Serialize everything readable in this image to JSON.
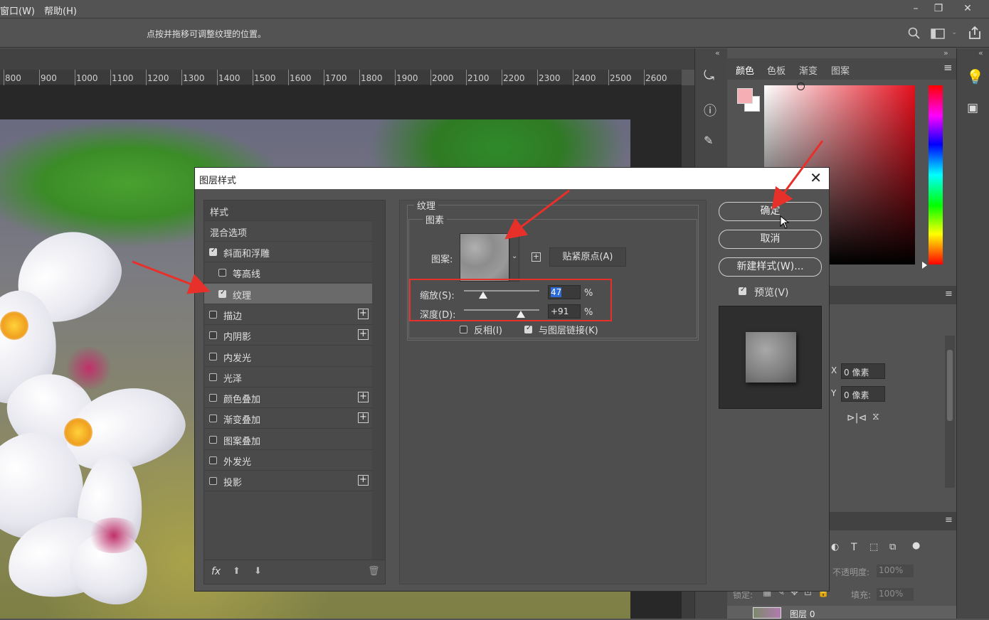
{
  "menubar": {
    "items": [
      "窗口(W)",
      "帮助(H)"
    ],
    "window_controls": [
      "minimize-icon",
      "restore-icon",
      "close-icon"
    ]
  },
  "options_bar": {
    "hint": "点按并拖移可调整纹理的位置。",
    "icons": [
      "search-icon",
      "workspace-icon",
      "share-icon"
    ]
  },
  "ruler": {
    "ticks": [
      "800",
      "900",
      "1000",
      "1100",
      "1200",
      "1300",
      "1400",
      "1500",
      "1600",
      "1700",
      "1800",
      "1900",
      "2000",
      "2100",
      "2200",
      "2300",
      "2400",
      "2500",
      "2600"
    ]
  },
  "color_panel": {
    "tabs": [
      "颜色",
      "色板",
      "渐变",
      "图案"
    ],
    "foreground": "#f5aeb4",
    "background": "#ffffff",
    "hue": "#e5101e"
  },
  "properties_panel": {
    "x_label": "X",
    "x_value": "0 像素",
    "y_label": "Y",
    "y_value": "0 像素"
  },
  "layers_panel": {
    "opacity_label": "不透明度:",
    "opacity_value": "100%",
    "lock_label": "锁定:",
    "fill_label": "填充:",
    "fill_value": "100%",
    "layer_name": "图层 0"
  },
  "dialog": {
    "title": "图层样式",
    "style_list": {
      "header": "样式",
      "blend": "混合选项",
      "items": [
        {
          "label": "斜面和浮雕",
          "checked": true,
          "indent": false,
          "plus": false
        },
        {
          "label": "等高线",
          "checked": false,
          "indent": true,
          "plus": false
        },
        {
          "label": "纹理",
          "checked": true,
          "indent": true,
          "plus": false,
          "active": true
        },
        {
          "label": "描边",
          "checked": false,
          "indent": false,
          "plus": true
        },
        {
          "label": "内阴影",
          "checked": false,
          "indent": false,
          "plus": true
        },
        {
          "label": "内发光",
          "checked": false,
          "indent": false,
          "plus": false
        },
        {
          "label": "光泽",
          "checked": false,
          "indent": false,
          "plus": false
        },
        {
          "label": "颜色叠加",
          "checked": false,
          "indent": false,
          "plus": true
        },
        {
          "label": "渐变叠加",
          "checked": false,
          "indent": false,
          "plus": true
        },
        {
          "label": "图案叠加",
          "checked": false,
          "indent": false,
          "plus": false
        },
        {
          "label": "外发光",
          "checked": false,
          "indent": false,
          "plus": false
        },
        {
          "label": "投影",
          "checked": false,
          "indent": false,
          "plus": true
        }
      ],
      "footer_fx": "fx"
    },
    "texture": {
      "section_title": "纹理",
      "group_title": "图素",
      "pattern_label": "图案:",
      "snap_button": "贴紧原点(A)",
      "scale_label": "缩放(S):",
      "scale_value": "47",
      "scale_fraction": 0.25,
      "depth_label": "深度(D):",
      "depth_value": "+91",
      "depth_fraction": 0.75,
      "percent": "%",
      "invert_label": "反相(I)",
      "invert_checked": false,
      "link_label": "与图层链接(K)",
      "link_checked": true
    },
    "buttons": {
      "ok": "确定",
      "cancel": "取消",
      "new_style": "新建样式(W)...",
      "preview_label": "预览(V)",
      "preview_checked": true
    }
  }
}
